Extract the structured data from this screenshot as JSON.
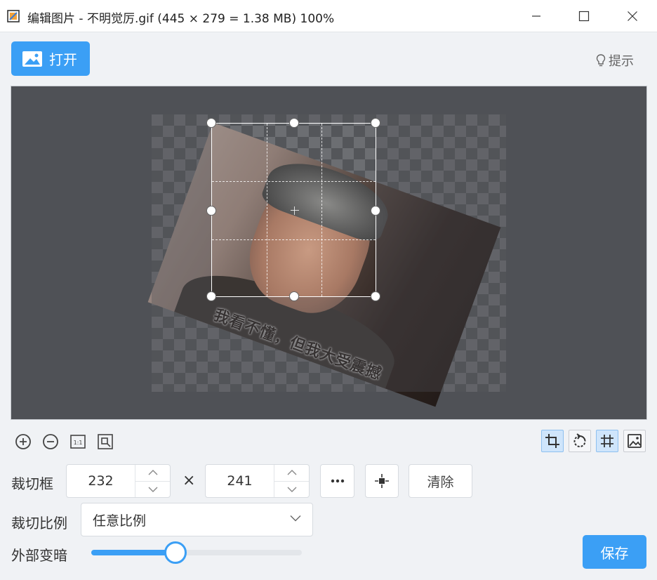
{
  "window": {
    "title": "编辑图片 - 不明觉厉.gif (445 × 279 = 1.38 MB) 100%",
    "min_icon": "minimize-icon",
    "max_icon": "maximize-icon",
    "close_icon": "close-icon"
  },
  "toolbar": {
    "open_label": "打开",
    "hint_label": "提示"
  },
  "image": {
    "caption": "我看不懂，但我大受震撼"
  },
  "view_tools": [
    "zoom-in-icon",
    "zoom-out-icon",
    "actual-size-icon",
    "fit-window-icon"
  ],
  "mode_tools": [
    {
      "icon": "crop-icon",
      "active": true
    },
    {
      "icon": "rotate-icon",
      "active": false
    },
    {
      "icon": "grid-icon",
      "active": true
    },
    {
      "icon": "image-adjust-icon",
      "active": false
    }
  ],
  "crop": {
    "label": "裁切框",
    "width": "232",
    "height": "241",
    "times": "×",
    "more_icon": "more-icon",
    "center_icon": "center-icon",
    "clear_label": "清除"
  },
  "ratio": {
    "label": "裁切比例",
    "selected": "任意比例"
  },
  "darken": {
    "label": "外部变暗",
    "value": 0.4
  },
  "save_label": "保存",
  "colors": {
    "accent": "#3b9ff5",
    "canvas_bg": "#4f5156"
  }
}
